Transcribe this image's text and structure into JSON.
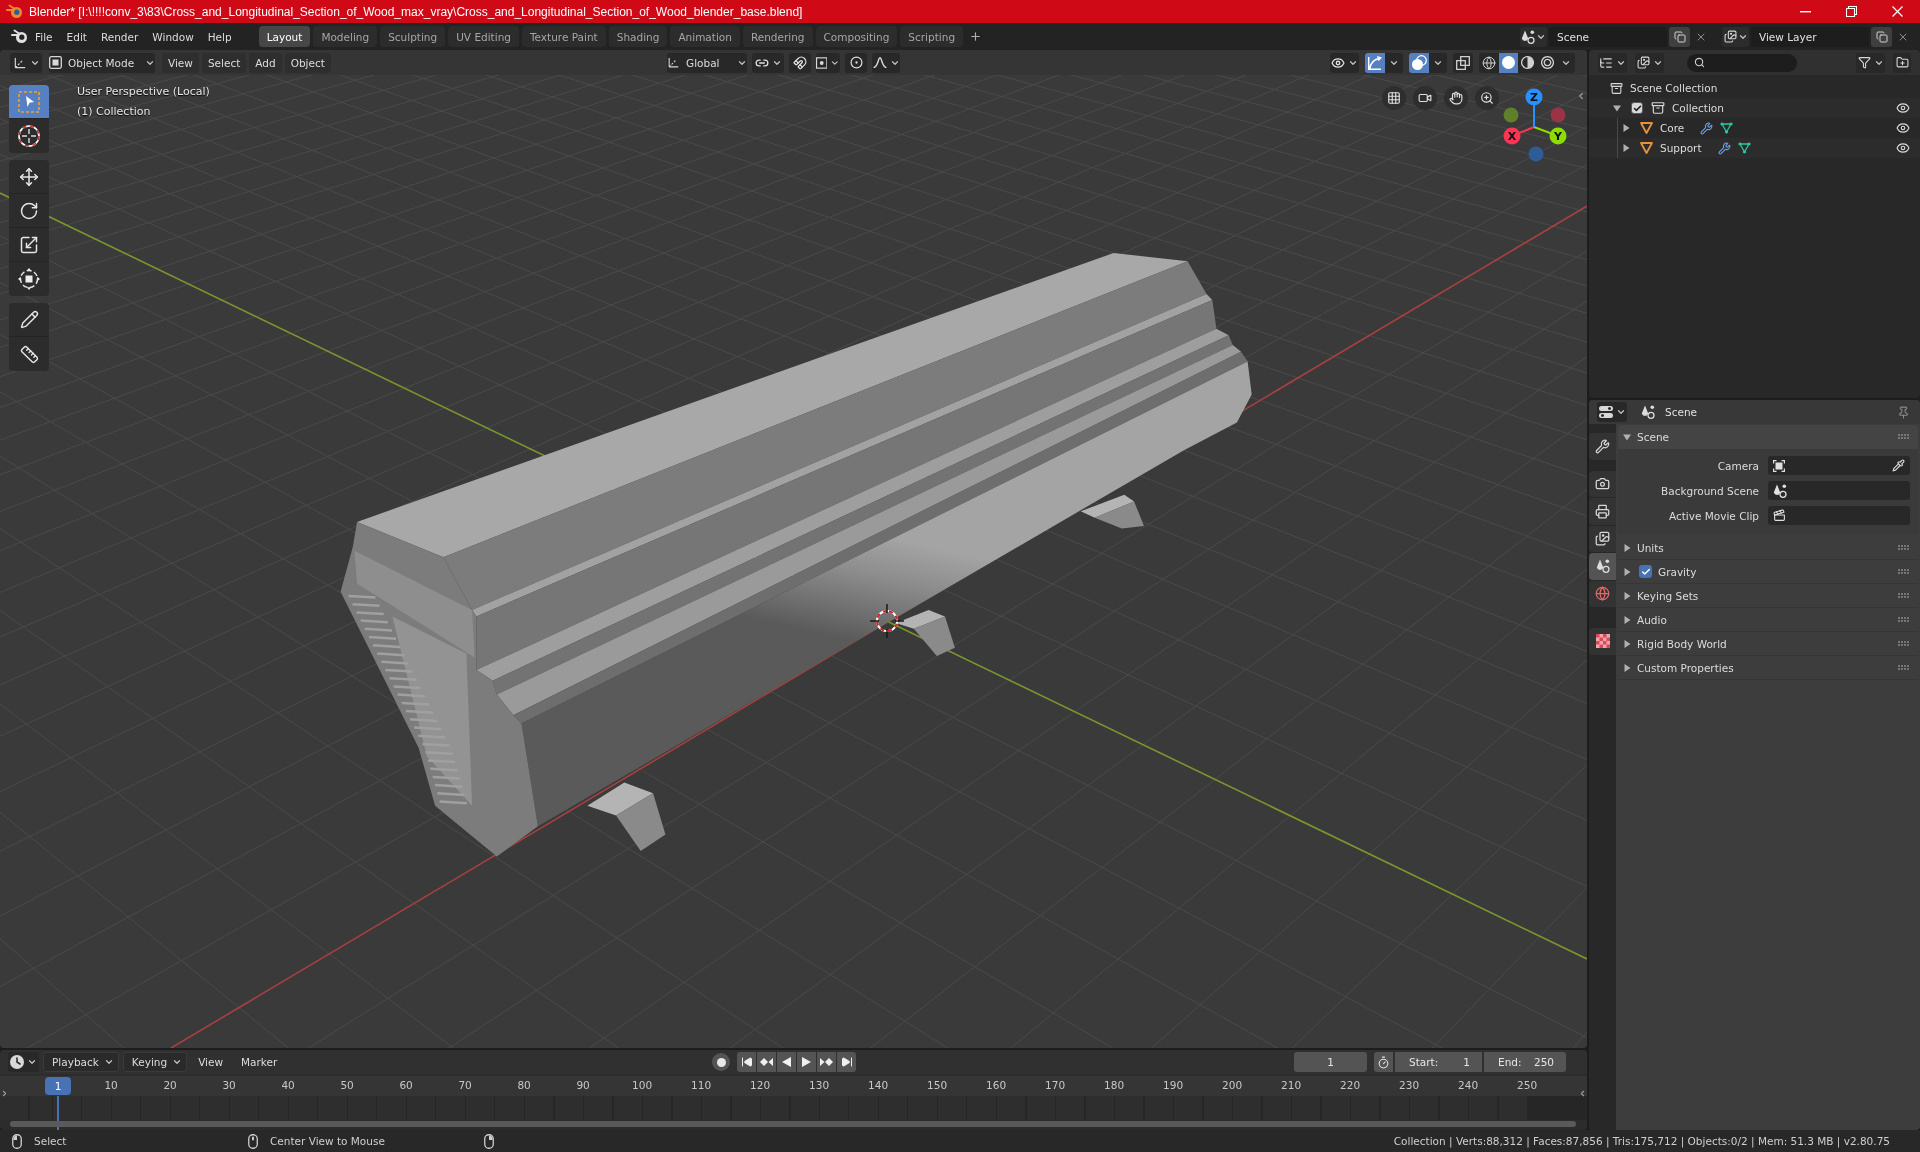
{
  "window": {
    "title": "Blender* [I:\\!!!!conv_3\\83\\Cross_and_Longitudinal_Section_of_Wood_max_vray\\Cross_and_Longitudinal_Section_of_Wood_blender_base.blend]"
  },
  "menu": [
    "File",
    "Edit",
    "Render",
    "Window",
    "Help"
  ],
  "workspaces": [
    {
      "label": "Layout",
      "selected": true
    },
    {
      "label": "Modeling",
      "selected": false
    },
    {
      "label": "Sculpting",
      "selected": false
    },
    {
      "label": "UV Editing",
      "selected": false
    },
    {
      "label": "Texture Paint",
      "selected": false
    },
    {
      "label": "Shading",
      "selected": false
    },
    {
      "label": "Animation",
      "selected": false
    },
    {
      "label": "Rendering",
      "selected": false
    },
    {
      "label": "Compositing",
      "selected": false
    },
    {
      "label": "Scripting",
      "selected": false
    }
  ],
  "scene": {
    "value": "Scene"
  },
  "view_layer": {
    "value": "View Layer"
  },
  "viewport": {
    "mode": "Object Mode",
    "menus": [
      "View",
      "Select",
      "Add",
      "Object"
    ],
    "orientation": "Global",
    "toggles": [
      {
        "kind": "gizmo",
        "on": true
      },
      {
        "kind": "overlay",
        "on": true
      },
      {
        "kind": "xray",
        "on": false
      }
    ],
    "shading": [
      {
        "kind": "wireframe",
        "selected": false
      },
      {
        "kind": "solid",
        "selected": true
      },
      {
        "kind": "material",
        "selected": false
      },
      {
        "kind": "rendered",
        "selected": false
      }
    ],
    "info": [
      "User Perspective (Local)",
      "(1) Collection"
    ],
    "toolbar": [
      {
        "tools": [
          {
            "kind": "select",
            "selected": true
          },
          {
            "kind": "cursor",
            "selected": false
          }
        ]
      },
      {
        "tools": [
          {
            "kind": "move",
            "selected": false
          },
          {
            "kind": "rotate",
            "selected": false
          },
          {
            "kind": "scale",
            "selected": false
          },
          {
            "kind": "transform",
            "selected": false
          }
        ]
      },
      {
        "tools": [
          {
            "kind": "annotate",
            "selected": false
          },
          {
            "kind": "measure",
            "selected": false
          }
        ]
      }
    ],
    "gizmo": [
      {
        "kind": "x",
        "label": "X"
      },
      {
        "kind": "y",
        "label": "Y"
      },
      {
        "kind": "z",
        "label": "Z"
      }
    ]
  },
  "outliner": {
    "root": "Scene Collection",
    "items": [
      {
        "label": "Collection",
        "expanded": true,
        "checked": true,
        "visible": true,
        "children": [
          {
            "label": "Core",
            "expanded": false,
            "visible": true
          },
          {
            "label": "Support",
            "expanded": false,
            "visible": true
          }
        ]
      }
    ]
  },
  "properties": {
    "context": "Scene",
    "tab_groups": [
      {
        "tabs": [
          {
            "kind": "tool",
            "selected": false
          }
        ]
      },
      {
        "tabs": [
          {
            "kind": "render",
            "selected": false
          },
          {
            "kind": "output",
            "selected": false
          },
          {
            "kind": "view_layer",
            "selected": false
          },
          {
            "kind": "scene",
            "selected": true
          },
          {
            "kind": "world",
            "selected": false
          }
        ]
      },
      {
        "tabs": [
          {
            "kind": "texture",
            "selected": false
          }
        ]
      }
    ],
    "panels": [
      {
        "label": "Scene",
        "expanded": true,
        "fields": [
          {
            "label": "Camera",
            "kind": "camera"
          },
          {
            "label": "Background Scene",
            "kind": "scene"
          },
          {
            "label": "Active Movie Clip",
            "kind": "clip"
          }
        ]
      },
      {
        "label": "Units",
        "expanded": false
      },
      {
        "label": "Gravity",
        "expanded": false,
        "toggle": {
          "checked": true
        }
      },
      {
        "label": "Keying Sets",
        "expanded": false
      },
      {
        "label": "Audio",
        "expanded": false
      },
      {
        "label": "Rigid Body World",
        "expanded": false
      },
      {
        "label": "Custom Properties",
        "expanded": false
      }
    ]
  },
  "timeline": {
    "menus": [
      {
        "label": "Playback",
        "dropdown": true
      },
      {
        "label": "Keying",
        "dropdown": true
      },
      {
        "label": "View",
        "dropdown": false
      },
      {
        "label": "Marker",
        "dropdown": false
      }
    ],
    "current_frame": "1",
    "start": {
      "label": "Start:",
      "value": "1"
    },
    "end": {
      "label": "End:",
      "value": "250"
    },
    "playhead": "1",
    "ruler": [
      "10",
      "20",
      "30",
      "40",
      "50",
      "60",
      "70",
      "80",
      "90",
      "100",
      "110",
      "120",
      "130",
      "140",
      "150",
      "160",
      "170",
      "180",
      "190",
      "200",
      "210",
      "220",
      "230",
      "240",
      "250"
    ]
  },
  "status_bar": {
    "hints": [
      "Select",
      "Center View to Mouse"
    ],
    "stats": "Collection | Verts:88,312 | Faces:87,856 | Tris:175,712 | Objects:0/2 | Mem: 51.3 MB | v2.80.75"
  }
}
